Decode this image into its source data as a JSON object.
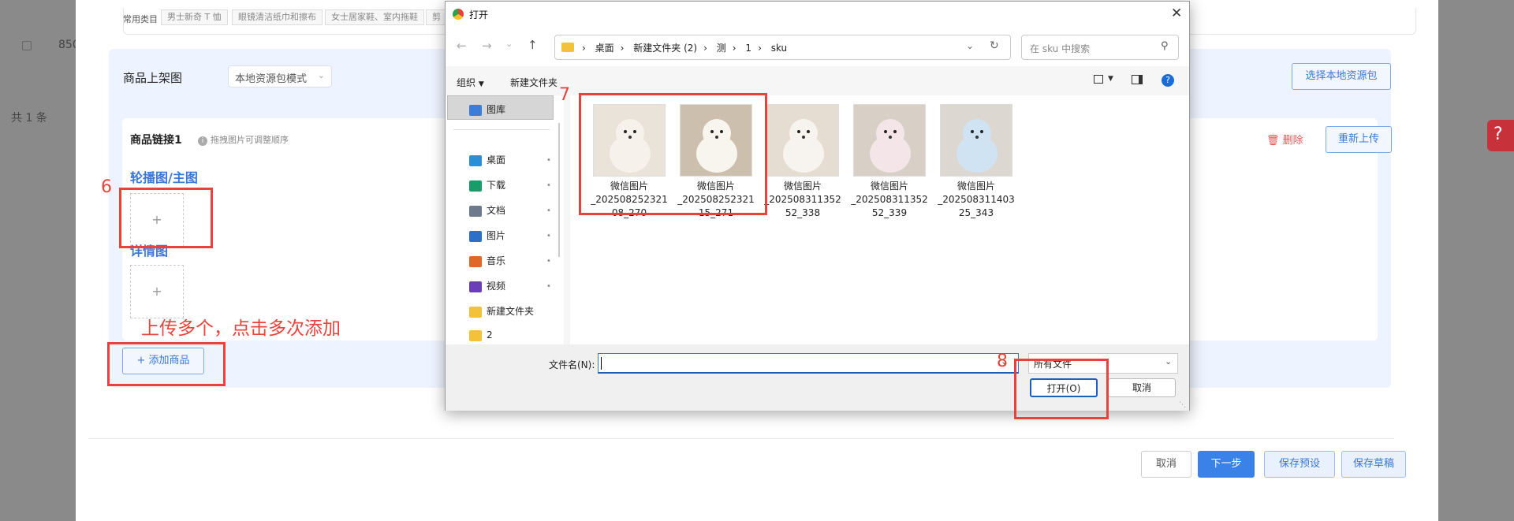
{
  "background": {
    "row_number": "850",
    "total_count": "共 1 条"
  },
  "categories": {
    "label": "常用类目",
    "tags": [
      "男士新奇 T 恤",
      "眼镜清洁纸巾和擦布",
      "女士居家鞋、室内拖鞋",
      "剪"
    ]
  },
  "upload_mode": {
    "label": "商品上架图",
    "select_value": "本地资源包模式",
    "select_local_button": "选择本地资源包"
  },
  "product": {
    "link_title": "商品链接1",
    "drag_hint": "拖拽图片可调整顺序",
    "delete_label": "删除",
    "reupload_label": "重新上传",
    "carousel_title": "轮播图/主图",
    "detail_title": "详情图",
    "plus": "+",
    "add_product_label": "添加商品"
  },
  "annotations": {
    "n6": "6",
    "n7": "7",
    "n8": "8",
    "note": "上传多个，点击多次添加",
    "color": "#e8423a"
  },
  "footer": {
    "cancel": "取消",
    "next": "下一步",
    "save_preset": "保存预设",
    "save_draft": "保存草稿"
  },
  "help_badge": "?",
  "dialog": {
    "title": "打开",
    "breadcrumb": [
      "桌面",
      "新建文件夹 (2)",
      "测",
      "1",
      "sku"
    ],
    "search_placeholder": "在 sku 中搜索",
    "organize": "组织",
    "new_folder": "新建文件夹",
    "nav_items": [
      {
        "label": "图库",
        "icon": "gallery-icon",
        "color": "#3b7dd8",
        "pinned": false
      },
      {
        "label": "桌面",
        "icon": "desktop-icon",
        "color": "#2b8fd8",
        "pinned": true
      },
      {
        "label": "下载",
        "icon": "download-icon",
        "color": "#1a9c6a",
        "pinned": true
      },
      {
        "label": "文档",
        "icon": "documents-icon",
        "color": "#6c7a8c",
        "pinned": true
      },
      {
        "label": "图片",
        "icon": "pictures-icon",
        "color": "#2b6fc8",
        "pinned": true
      },
      {
        "label": "音乐",
        "icon": "music-icon",
        "color": "#e0662a",
        "pinned": true
      },
      {
        "label": "视频",
        "icon": "videos-icon",
        "color": "#6a3fb8",
        "pinned": true
      },
      {
        "label": "新建文件夹",
        "icon": "folder-icon",
        "color": "#f3c23a",
        "pinned": false
      },
      {
        "label": "2",
        "icon": "folder-icon",
        "color": "#f3c23a",
        "pinned": false
      }
    ],
    "files": [
      {
        "line1": "微信图片",
        "line2": "_202508252321",
        "line3": "08_270",
        "bg": "#e9e3da",
        "subject": "#f6f1ea"
      },
      {
        "line1": "微信图片",
        "line2": "_202508252321",
        "line3": "15_271",
        "bg": "#cdbfae",
        "subject": "#f8f5ef"
      },
      {
        "line1": "微信图片",
        "line2": "_202508311352",
        "line3": "52_338",
        "bg": "#e6ddd2",
        "subject": "#f7f3ee"
      },
      {
        "line1": "微信图片",
        "line2": "_202508311352",
        "line3": "52_339",
        "bg": "#d8cfc6",
        "subject": "#f4e5e8"
      },
      {
        "line1": "微信图片",
        "line2": "_202508311403",
        "line3": "25_343",
        "bg": "#ddd7d2",
        "subject": "#cfe3f3"
      }
    ],
    "filename_label": "文件名(N):",
    "filename_value": "",
    "filetype_value": "所有文件",
    "open": "打开(O)",
    "cancel": "取消"
  }
}
